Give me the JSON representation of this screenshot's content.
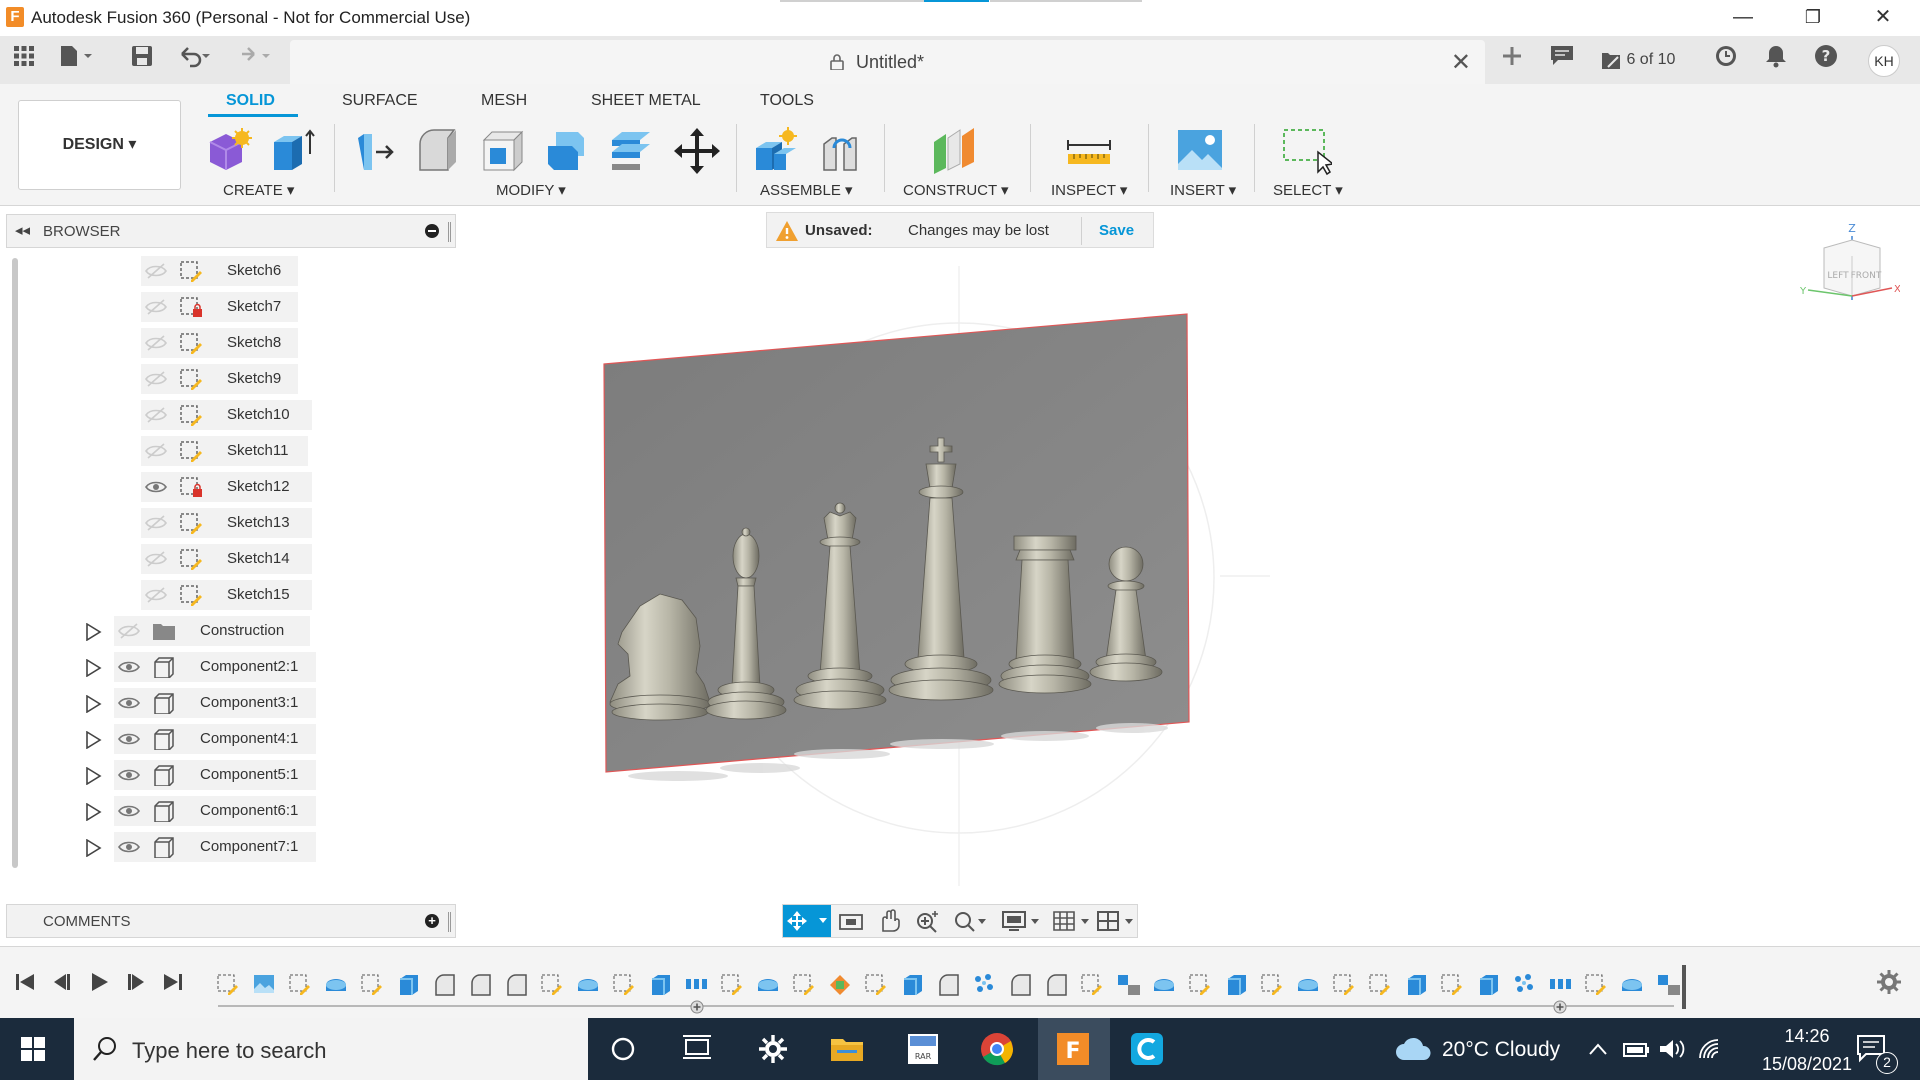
{
  "window": {
    "title": "Autodesk Fusion 360 (Personal - Not for Commercial Use)",
    "logo_letter": "F",
    "minimize": "—",
    "restore": "❐",
    "close": "✕"
  },
  "doc_tab": {
    "title": "Untitled*",
    "close": "✕",
    "jobs_count": "6 of 10",
    "user_initials": "KH"
  },
  "ribbon": {
    "workspace": "DESIGN ▾",
    "tabs": [
      "SOLID",
      "SURFACE",
      "MESH",
      "SHEET METAL",
      "TOOLS"
    ],
    "groups": [
      "CREATE ▾",
      "MODIFY ▾",
      "ASSEMBLE ▾",
      "CONSTRUCT ▾",
      "INSPECT ▾",
      "INSERT ▾",
      "SELECT ▾"
    ]
  },
  "browser": {
    "label": "BROWSER",
    "collapse": "◂◂",
    "sketches": [
      "Sketch6",
      "Sketch7",
      "Sketch8",
      "Sketch9",
      "Sketch10",
      "Sketch11",
      "Sketch12",
      "Sketch13",
      "Sketch14",
      "Sketch15"
    ],
    "nodes": [
      "Construction",
      "Component2:1",
      "Component3:1",
      "Component4:1",
      "Component5:1",
      "Component6:1",
      "Component7:1"
    ]
  },
  "unsaved": {
    "label": "Unsaved:",
    "message": "Changes may be lost",
    "action": "Save"
  },
  "comments": {
    "label": "COMMENTS",
    "add": "+"
  },
  "viewcube": {
    "top": "Z",
    "left_face": "LEFT",
    "front_face": "FRONT",
    "axis_x": "X",
    "axis_y": "Y"
  },
  "taskbar": {
    "search_placeholder": "Type here to search",
    "weather": "20°C  Cloudy",
    "time": "14:26",
    "date": "15/08/2021",
    "notifications": "2"
  },
  "colors": {
    "accent": "#0696d7",
    "taskbar": "#1b2b3c",
    "canvas_plane": "#8a8a8a",
    "chess_piece": "#bdbbae",
    "fusion_logo": "#f28c28"
  }
}
